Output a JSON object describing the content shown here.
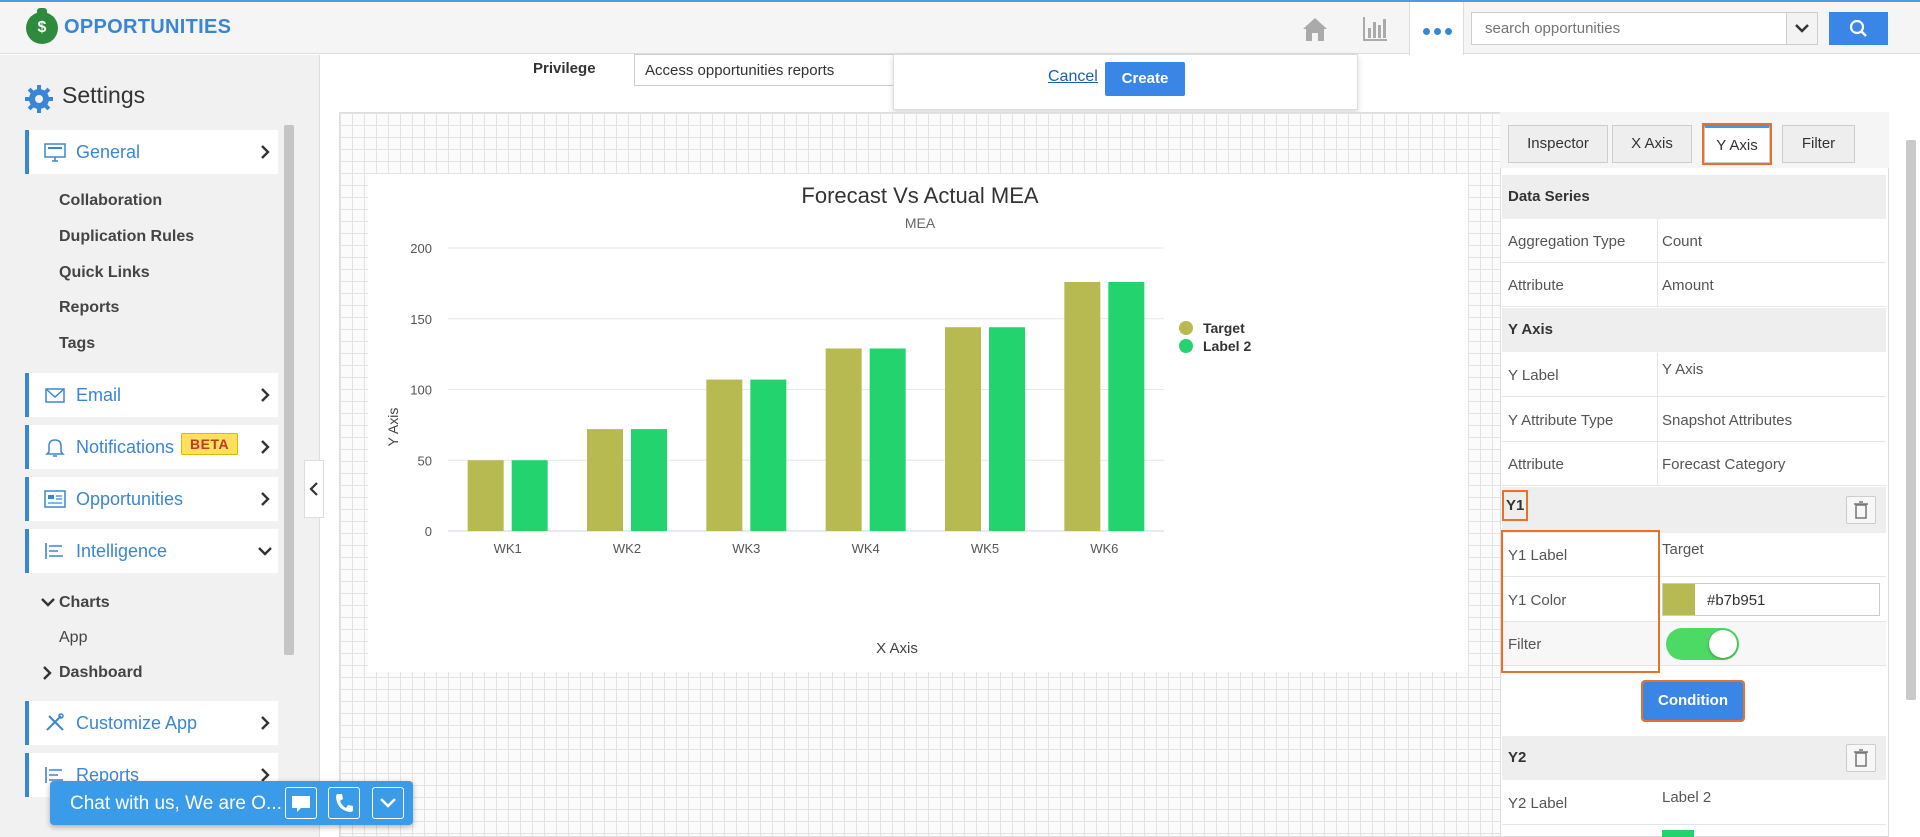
{
  "app": {
    "title": "OPPORTUNITIES",
    "logo_icon": "money-bag-icon"
  },
  "search": {
    "placeholder": "search opportunities"
  },
  "colors": {
    "accent": "#3a86d6",
    "highlight": "#e8702a",
    "series1": "#b7b951",
    "series2": "#22d36e",
    "toggle_on": "#4cd964",
    "beta": "#fde05b"
  },
  "sidebar": {
    "title": "Settings",
    "items": [
      {
        "label": "General",
        "icon": "monitor-icon"
      },
      {
        "label": "Email",
        "icon": "envelope-icon"
      },
      {
        "label": "Notifications",
        "icon": "bell-icon",
        "badge": "BETA"
      },
      {
        "label": "Opportunities",
        "icon": "dashboard-icon"
      },
      {
        "label": "Intelligence",
        "icon": "bars-icon"
      },
      {
        "label": "Customize App",
        "icon": "tools-icon"
      },
      {
        "label": "Reports",
        "icon": "report-icon"
      }
    ],
    "general_sub": [
      "Collaboration",
      "Duplication Rules",
      "Quick Links",
      "Reports",
      "Tags"
    ],
    "intelligence_sub": {
      "charts": "Charts",
      "app": "App",
      "dashboard": "Dashboard"
    }
  },
  "form": {
    "privilege_label": "Privilege",
    "privilege_value": "Access opportunities reports",
    "cancel": "Cancel",
    "create": "Create"
  },
  "chart_data": {
    "type": "bar",
    "title": "Forecast Vs Actual MEA",
    "subtitle": "MEA",
    "xlabel": "X Axis",
    "ylabel": "Y Axis",
    "ylim": [
      0,
      200
    ],
    "yticks": [
      0,
      50,
      100,
      150,
      200
    ],
    "categories": [
      "WK1",
      "WK2",
      "WK3",
      "WK4",
      "WK5",
      "WK6"
    ],
    "series": [
      {
        "name": "Target",
        "color": "#b7b951",
        "values": [
          50,
          72,
          107,
          129,
          144,
          176
        ]
      },
      {
        "name": "Label 2",
        "color": "#22d36e",
        "values": [
          50,
          72,
          107,
          129,
          144,
          176
        ]
      }
    ],
    "grid": true,
    "legend": "right"
  },
  "panel": {
    "tabs": [
      "Inspector",
      "X Axis",
      "Y Axis",
      "Filter"
    ],
    "active_tab": "Y Axis",
    "data_series": {
      "head": "Data Series",
      "agg_label": "Aggregation Type",
      "agg_value": "Count",
      "attr_label": "Attribute",
      "attr_value": "Amount"
    },
    "y_axis": {
      "head": "Y Axis",
      "label_k": "Y Label",
      "label_v": "Y Axis",
      "attr_type_k": "Y Attribute Type",
      "attr_type_v": "Snapshot Attributes",
      "attr_k": "Attribute",
      "attr_v": "Forecast Category"
    },
    "y1": {
      "head": "Y1",
      "label_k": "Y1 Label",
      "label_v": "Target",
      "color_k": "Y1 Color",
      "color_v": "#b7b951",
      "filter_k": "Filter",
      "filter_on": true,
      "condition": "Condition"
    },
    "y2": {
      "head": "Y2",
      "label_k": "Y2 Label",
      "label_v": "Label 2"
    }
  },
  "chat": {
    "text": "Chat with us, We are O..."
  }
}
